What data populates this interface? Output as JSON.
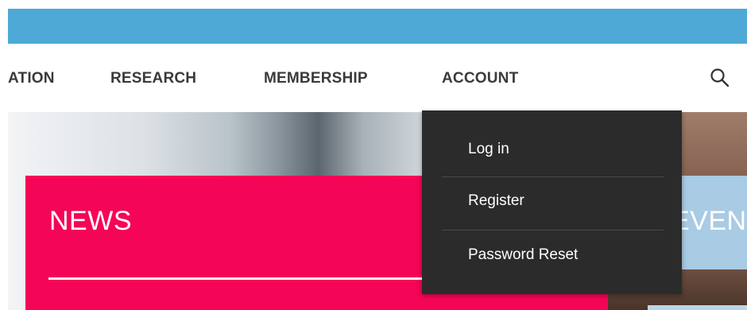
{
  "nav": {
    "items": [
      {
        "label": "ATION"
      },
      {
        "label": "RESEARCH"
      },
      {
        "label": "MEMBERSHIP"
      },
      {
        "label": "ACCOUNT"
      }
    ],
    "search_icon": "search-icon"
  },
  "account_menu": {
    "items": [
      {
        "label": "Log in"
      },
      {
        "label": "Register"
      },
      {
        "label": "Password Reset"
      }
    ]
  },
  "news": {
    "title": "NEWS"
  },
  "events": {
    "title": "EVEN"
  },
  "colors": {
    "top_bar": "#4ea9d6",
    "news_panel": "#f50557",
    "events_panel": "#a9cbe3",
    "dropdown": "#2b2b2b",
    "nav_text": "#3a3a3a"
  }
}
